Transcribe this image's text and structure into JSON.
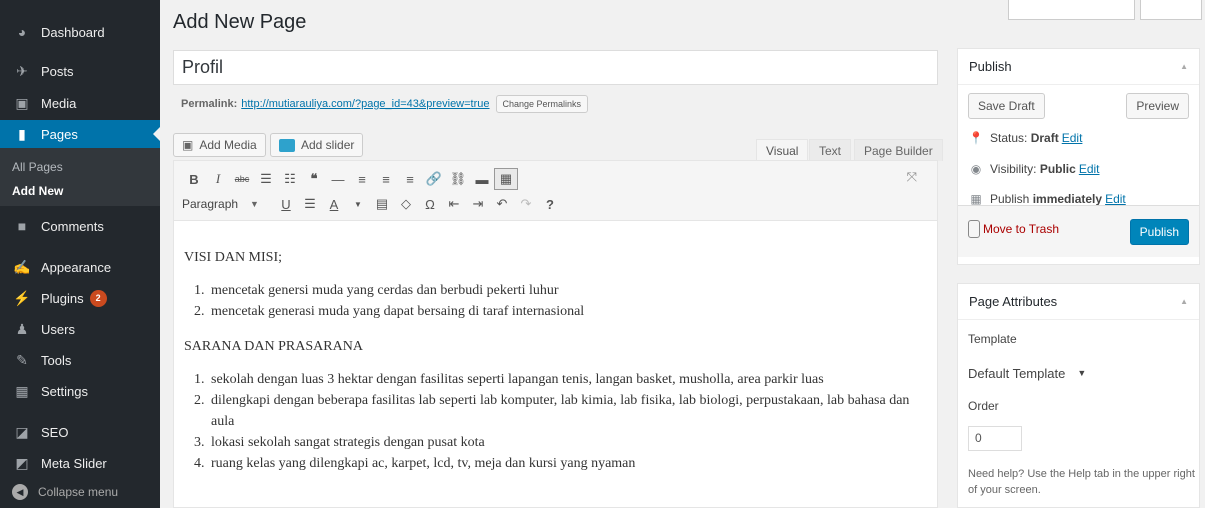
{
  "sidebar": {
    "items": [
      {
        "label": "Dashboard",
        "icon": "dashboard-icon"
      },
      {
        "label": "Posts",
        "icon": "pin-icon"
      },
      {
        "label": "Media",
        "icon": "media-icon"
      },
      {
        "label": "Pages",
        "icon": "page-icon"
      },
      {
        "label": "Comments",
        "icon": "comment-icon"
      },
      {
        "label": "Appearance",
        "icon": "paintbrush-icon"
      },
      {
        "label": "Plugins",
        "icon": "plugin-icon",
        "badge": "2"
      },
      {
        "label": "Users",
        "icon": "users-icon"
      },
      {
        "label": "Tools",
        "icon": "wrench-icon"
      },
      {
        "label": "Settings",
        "icon": "settings-icon"
      },
      {
        "label": "SEO",
        "icon": "seo-icon"
      },
      {
        "label": "Meta Slider",
        "icon": "slider-icon"
      }
    ],
    "submenu": {
      "all_pages": "All Pages",
      "add_new": "Add New"
    },
    "collapse": "Collapse menu",
    "active_color": "#0073aa"
  },
  "heading": "Add New Page",
  "title_value": "Profil",
  "permalink": {
    "label": "Permalink:",
    "url": "http://mutiarauliya.com/?page_id=43&preview=true",
    "button": "Change Permalinks"
  },
  "media_buttons": {
    "add_media": "Add Media",
    "add_slider": "Add slider"
  },
  "editor_tabs": {
    "visual": "Visual",
    "text": "Text",
    "page_builder": "Page Builder"
  },
  "toolbar": {
    "format": "Paragraph"
  },
  "content": {
    "heading1": "VISI DAN MISI;",
    "list1": [
      "mencetak genersi muda yang cerdas dan berbudi pekerti luhur",
      "mencetak generasi muda yang dapat bersaing di taraf internasional"
    ],
    "heading2": "SARANA DAN PRASARANA",
    "list2": [
      "sekolah dengan luas 3 hektar dengan fasilitas seperti lapangan tenis, langan basket, musholla, area parkir luas",
      "dilengkapi dengan beberapa fasilitas lab seperti lab komputer, lab kimia, lab fisika, lab biologi, perpustakaan, lab bahasa dan aula",
      "lokasi sekolah sangat strategis dengan pusat kota",
      "ruang kelas yang dilengkapi ac, karpet, lcd, tv, meja dan kursi yang nyaman"
    ]
  },
  "publish": {
    "title": "Publish",
    "save_draft": "Save Draft",
    "preview": "Preview",
    "status_label": "Status:",
    "status_value": "Draft",
    "visibility_label": "Visibility:",
    "visibility_value": "Public",
    "publish_label": "Publish",
    "publish_value": "immediately",
    "edit": "Edit",
    "trash": "Move to Trash",
    "publish_button": "Publish",
    "button_color": "#0085ba"
  },
  "attributes": {
    "title": "Page Attributes",
    "template_label": "Template",
    "template_value": "Default Template",
    "order_label": "Order",
    "order_value": "0",
    "help": "Need help? Use the Help tab in the upper right of your screen."
  }
}
